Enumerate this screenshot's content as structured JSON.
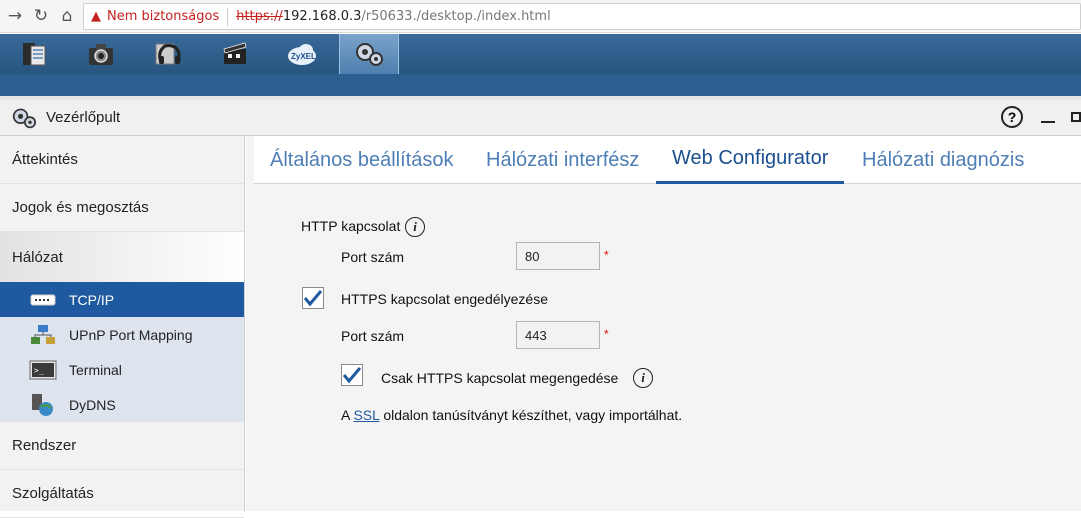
{
  "browser": {
    "not_secure": "Nem biztonságos",
    "url_scheme": "https://",
    "url_host": "192.168.0.3",
    "url_path": "/r50633./desktop./index.html"
  },
  "apps": [
    "file-browser-icon",
    "photo-icon",
    "music-icon",
    "video-icon",
    "zyxel-cloud-icon",
    "control-panel-icon"
  ],
  "zyxel_logo_text": "ZyXEL",
  "window": {
    "title": "Vezérlőpult",
    "help": "?"
  },
  "sidebar": {
    "items": [
      {
        "label": "Áttekintés"
      },
      {
        "label": "Jogok és megosztás"
      },
      {
        "label": "Hálózat"
      }
    ],
    "sub_items": [
      {
        "label": "TCP/IP"
      },
      {
        "label": "UPnP Port Mapping"
      },
      {
        "label": "Terminal"
      },
      {
        "label": "DyDNS"
      }
    ],
    "bottom_items": [
      {
        "label": "Rendszer"
      },
      {
        "label": "Szolgáltatás"
      }
    ]
  },
  "tabs": [
    {
      "label": "Általános beállítások"
    },
    {
      "label": "Hálózati interfész"
    },
    {
      "label": "Web Configurator"
    },
    {
      "label": "Hálózati diagnózis"
    }
  ],
  "form": {
    "http_label": "HTTP kapcsolat",
    "port_label": "Port szám",
    "http_port": "80",
    "required_mark": "*",
    "https_enable_label": "HTTPS kapcsolat engedélyezése",
    "https_port": "443",
    "https_only_label": "Csak HTTPS kapcsolat megengedése",
    "ssl_note_prefix": "A",
    "ssl_link": "SSL",
    "ssl_note_suffix": "oldalon tanúsítványt készíthet, vagy importálhat."
  }
}
